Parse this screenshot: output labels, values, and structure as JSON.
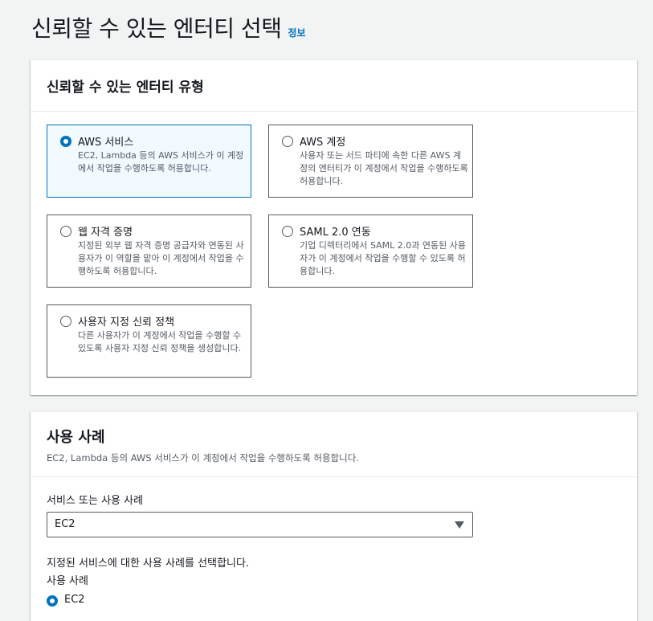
{
  "header": {
    "title": "신뢰할 수 있는 엔터티 선택",
    "info": "정보"
  },
  "trusted_entity": {
    "title": "신뢰할 수 있는 엔터티 유형",
    "options": [
      {
        "title": "AWS 서비스",
        "desc": "EC2, Lambda 등의 AWS 서비스가 이 계정에서 작업을 수행하도록 허용합니다.",
        "selected": true
      },
      {
        "title": "AWS 계정",
        "desc": "사용자 또는 서드 파티에 속한 다른 AWS 계정의 엔터티가 이 계정에서 작업을 수행하도록 허용합니다.",
        "selected": false
      },
      {
        "title": "웹 자격 증명",
        "desc": "지정된 외부 웹 자격 증명 공급자와 연동된 사용자가 이 역할을 맡아 이 계정에서 작업을 수행하도록 허용합니다.",
        "selected": false
      },
      {
        "title": "SAML 2.0 연동",
        "desc": "기업 디렉터리에서 SAML 2.0과 연동된 사용자가 이 계정에서 작업을 수행할 수 있도록 허용합니다.",
        "selected": false
      },
      {
        "title": "사용자 지정 신뢰 정책",
        "desc": "다른 사용자가 이 계정에서 작업을 수행할 수 있도록 사용자 지정 신뢰 정책을 생성합니다.",
        "selected": false
      }
    ]
  },
  "use_case": {
    "title": "사용 사례",
    "desc": "EC2, Lambda 등의 AWS 서비스가 이 계정에서 작업을 수행하도록 허용합니다.",
    "service_label": "서비스 또는 사용 사례",
    "service_value": "EC2",
    "hint": "지정된 서비스에 대한 사용 사례를 선택합니다.",
    "use_case_label": "사용 사례",
    "use_case_option": "EC2"
  }
}
